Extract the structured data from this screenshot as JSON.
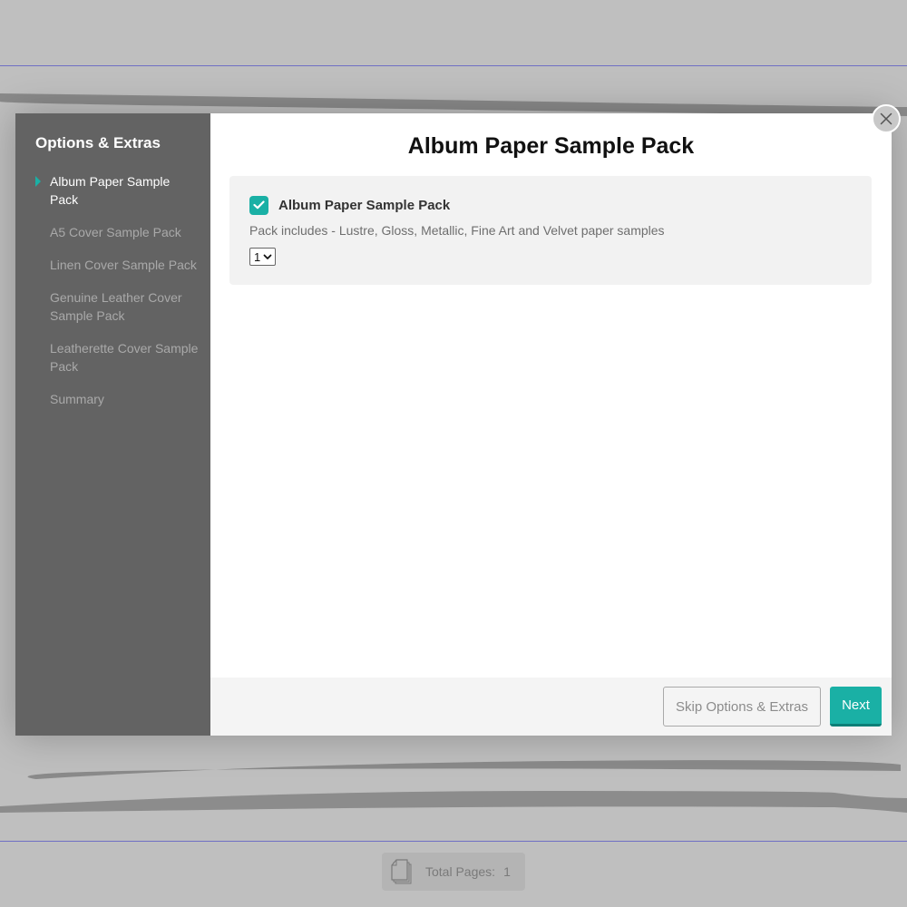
{
  "background": {
    "guide_color": "#6f6fc4"
  },
  "sidebar": {
    "title": "Options & Extras",
    "items": [
      {
        "label": "Album Paper Sample Pack",
        "active": true
      },
      {
        "label": "A5 Cover Sample Pack",
        "active": false
      },
      {
        "label": "Linen Cover Sample Pack",
        "active": false
      },
      {
        "label": "Genuine Leather Cover Sample Pack",
        "active": false
      },
      {
        "label": "Leatherette Cover Sample Pack",
        "active": false
      },
      {
        "label": "Summary",
        "active": false
      }
    ]
  },
  "main": {
    "title": "Album Paper Sample Pack",
    "option": {
      "checked": true,
      "name": "Album Paper Sample Pack",
      "description": "Pack includes - Lustre, Gloss, Metallic, Fine Art and Velvet paper samples",
      "quantity": "1"
    }
  },
  "footer": {
    "skip_label": "Skip Options & Extras",
    "next_label": "Next"
  },
  "colors": {
    "accent": "#1ab0a5",
    "sidebar_bg": "#636363"
  },
  "page_info": {
    "label": "Total Pages:",
    "value": "1"
  }
}
